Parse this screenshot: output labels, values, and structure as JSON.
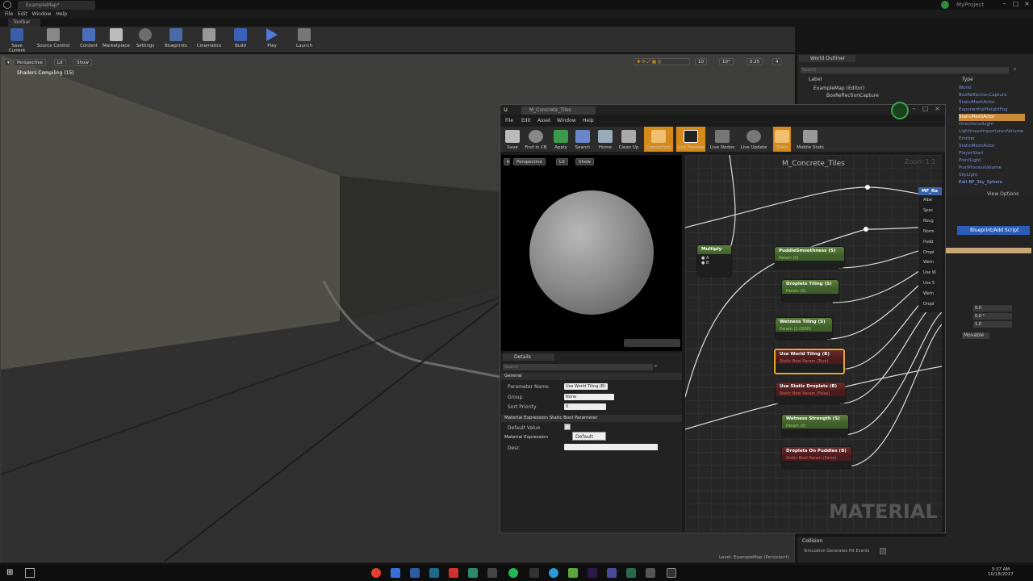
{
  "window": {
    "tab_title": "ExampleMap*",
    "project": "MyProject"
  },
  "menu": [
    "File",
    "Edit",
    "Window",
    "Help"
  ],
  "toolbar": {
    "tab": "Toolbar",
    "buttons": [
      "Save Current",
      "Source Control",
      "Content",
      "Marketplace",
      "Settings",
      "Blueprints",
      "Cinematics",
      "Build",
      "Play",
      "Launch"
    ]
  },
  "viewport": {
    "perspective": "Perspective",
    "lit": "Lit",
    "show": "Show",
    "status": "Shaders Compiling (15)",
    "snap_values": [
      "10",
      "10°",
      "0.25",
      "4"
    ],
    "level": "Level:  ExampleMap (Persistent)"
  },
  "outliner": {
    "tab": "World Outliner",
    "search": "Search",
    "col_label": "Label",
    "col_type": "Type",
    "rows": [
      {
        "label": "ExampleMap (Editor)",
        "type": "World"
      },
      {
        "label": "BoxReflectionCapture",
        "type": "BoxReflectionCapture"
      }
    ],
    "types": [
      "World",
      "BoxReflectionCapture",
      "StaticMeshActor",
      "ExponentialHeightFog",
      "StaticMeshActor",
      "DirectionalLight",
      "LightmassImportanceVolume",
      "Emitter",
      "StaticMeshActor",
      "PlayerStart",
      "PointLight",
      "PostProcessVolume",
      "SkyLight",
      "Edit BP_Sky_Sphere"
    ],
    "view_options": "View Options"
  },
  "material_editor": {
    "tab": "M_Concrete_Tiles",
    "menu": [
      "File",
      "Edit",
      "Asset",
      "Window",
      "Help"
    ],
    "buttons": [
      "Save",
      "Find in CB",
      "Apply",
      "Search",
      "Home",
      "Clean Up",
      "Connectors",
      "Live Preview",
      "Live Nodes",
      "Live Update",
      "Stats",
      "Mobile Stats"
    ],
    "preview": {
      "perspective": "Perspective",
      "lit": "Lit",
      "show": "Show"
    },
    "graph_title": "M_Concrete_Tiles",
    "zoom": "Zoom 1:1",
    "watermark": "MATERIAL",
    "multiply": {
      "title": "Multiply",
      "a": "A",
      "b": "B"
    },
    "result_node": {
      "title": "MF_Ra",
      "pins": [
        "Albe",
        "Spec",
        "Roug",
        "Norm",
        "Pudd",
        "Dropl",
        "Wetn",
        "Use W",
        "Use S",
        "Wetn",
        "Dropl"
      ]
    },
    "nodes": [
      {
        "title": "PuddleSmoothness (S)",
        "sub": "Param (0)",
        "kind": "green"
      },
      {
        "title": "Droplets Tiling (S)",
        "sub": "Param (0)",
        "kind": "green"
      },
      {
        "title": "Wetness Tiling (S)",
        "sub": "Param (1.0000)",
        "kind": "green"
      },
      {
        "title": "Use World Tiling (B)",
        "sub": "Static Bool Param (True)",
        "kind": "red"
      },
      {
        "title": "Use Static Droplets (B)",
        "sub": "Static Bool Param (False)",
        "kind": "red"
      },
      {
        "title": "Wetness Strength (S)",
        "sub": "Param (0)",
        "kind": "green"
      },
      {
        "title": "Droplets On Puddles (B)",
        "sub": "Static Bool Param (False)",
        "kind": "red"
      }
    ],
    "details": {
      "tab": "Details",
      "search": "Search",
      "general": "General",
      "param_name_label": "Parameter Name",
      "param_name_value": "Use World Tiling (B)",
      "group_label": "Group",
      "group_value": "None",
      "sort_label": "Sort Priority",
      "sort_value": "0",
      "section_bool": "Material Expression Static Bool Parameter",
      "default_label": "Default Value",
      "tooltip": "Default Value",
      "section_expr": "Material Expression",
      "desc_label": "Desc"
    }
  },
  "right_panel": {
    "add_script": "Blueprint/Add Script",
    "values": [
      "0.0",
      "0.0 °",
      "1.0"
    ],
    "mobility": "Movable",
    "collision": "Collision",
    "sim_hit": "Simulation Generates Hit Events"
  },
  "taskbar": {
    "time": "3:37 AM",
    "date": "10/18/2017"
  }
}
